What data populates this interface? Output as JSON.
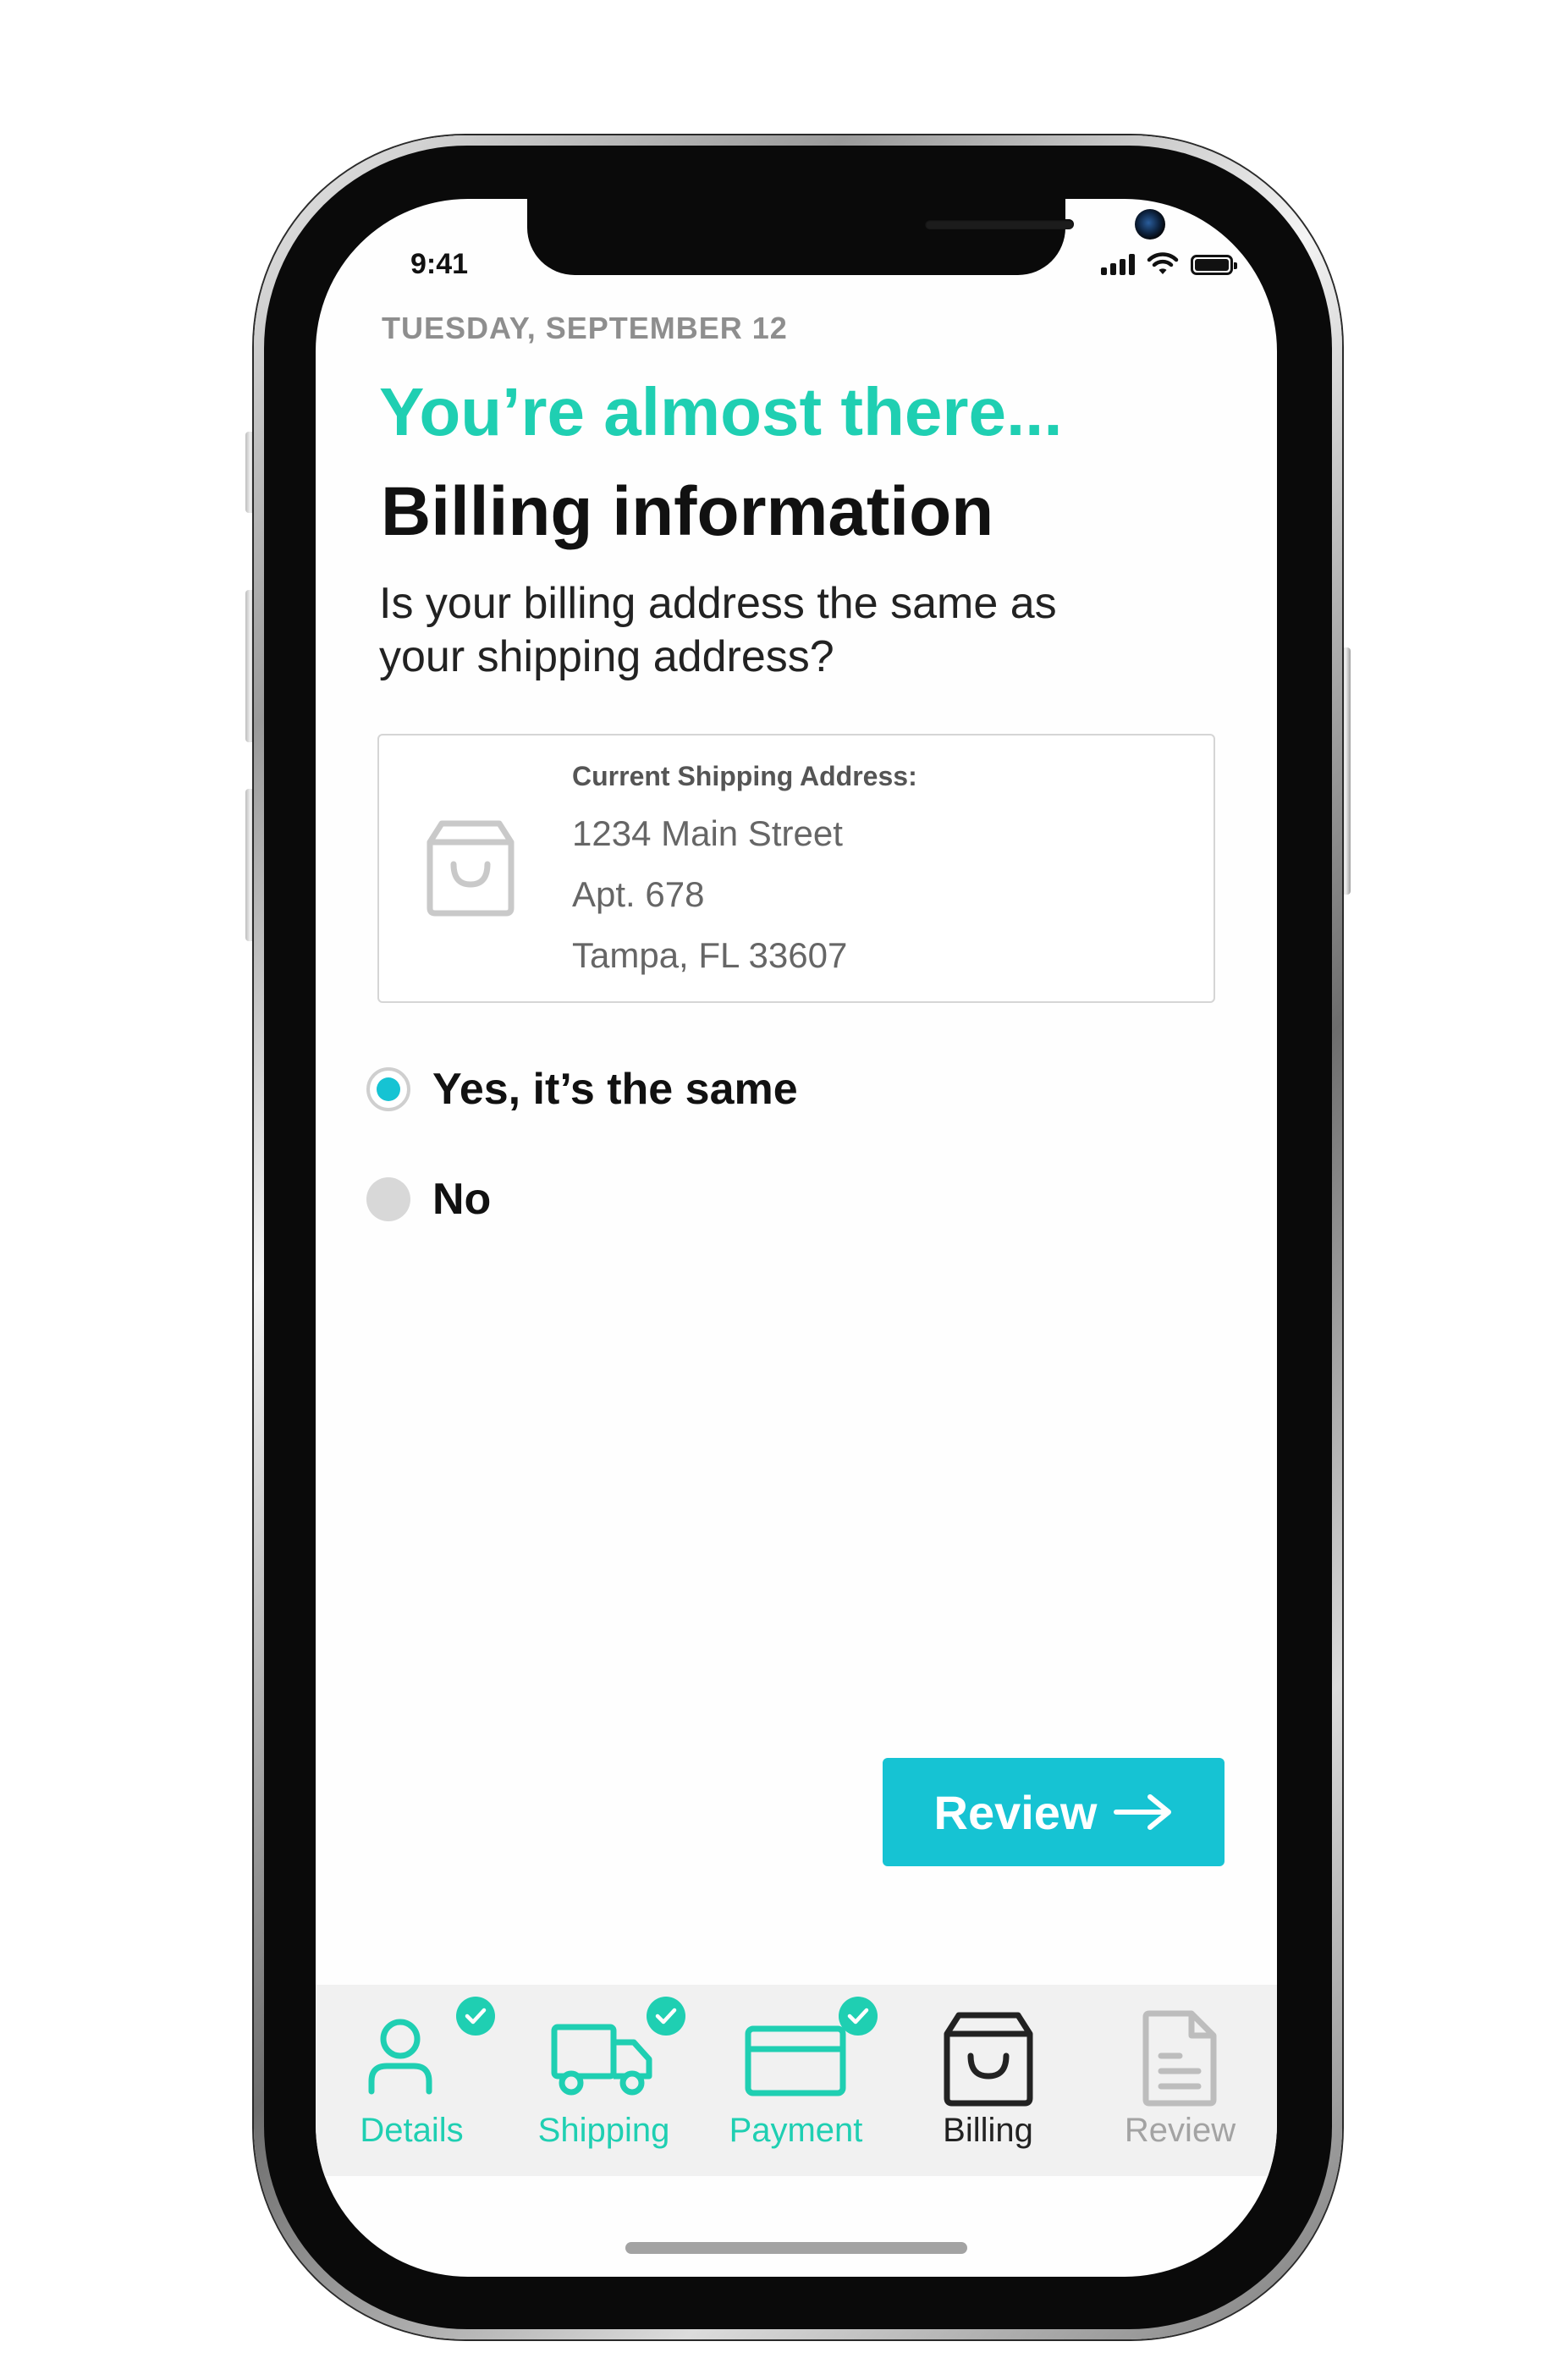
{
  "status_bar": {
    "time": "9:41"
  },
  "header": {
    "date": "TUESDAY, SEPTEMBER 12",
    "eyebrow": "You’re almost there...",
    "title": "Billing information",
    "question": "Is your billing address the same as your shipping address?"
  },
  "address_card": {
    "label": "Current Shipping Address:",
    "line1": "1234 Main Street",
    "line2": "Apt. 678",
    "line3": "Tampa, FL 33607",
    "icon": "shopping-bag-icon"
  },
  "options": [
    {
      "label": "Yes, it’s the same",
      "selected": true
    },
    {
      "label": "No",
      "selected": false
    }
  ],
  "primary_action": {
    "label": "Review",
    "icon": "arrow-right-icon"
  },
  "tabs": [
    {
      "label": "Details",
      "icon": "person-icon",
      "state": "complete"
    },
    {
      "label": "Shipping",
      "icon": "truck-icon",
      "state": "complete"
    },
    {
      "label": "Payment",
      "icon": "credit-card-icon",
      "state": "complete"
    },
    {
      "label": "Billing",
      "icon": "shopping-bag-icon",
      "state": "active"
    },
    {
      "label": "Review",
      "icon": "document-icon",
      "state": "upcoming"
    }
  ],
  "colors": {
    "accent_green": "#1fcfb2",
    "accent_teal": "#16c3d3",
    "active_tab": "#222222",
    "upcoming_tab": "#a3a3a3"
  }
}
